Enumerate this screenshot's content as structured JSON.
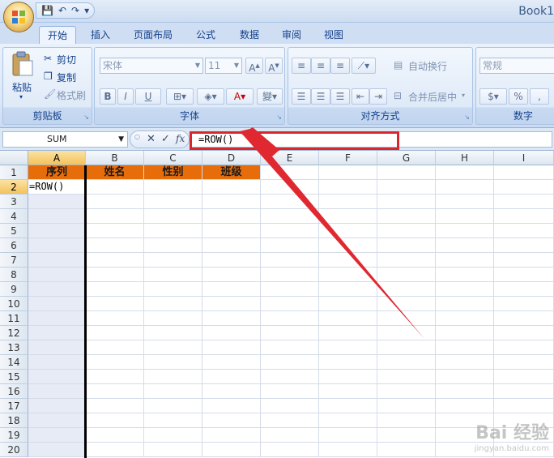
{
  "window": {
    "title": "Book1"
  },
  "quick_access": {
    "save": "💾",
    "undo": "↶",
    "redo": "↷",
    "customize": "▾"
  },
  "tabs": [
    {
      "label": "开始",
      "active": true
    },
    {
      "label": "插入"
    },
    {
      "label": "页面布局"
    },
    {
      "label": "公式"
    },
    {
      "label": "数据"
    },
    {
      "label": "审阅"
    },
    {
      "label": "视图"
    }
  ],
  "ribbon": {
    "clipboard": {
      "label": "剪贴板",
      "paste": "粘贴",
      "cut": "剪切",
      "copy": "复制",
      "format_painter": "格式刷"
    },
    "font": {
      "label": "字体",
      "font_name": "宋体",
      "font_size": "11",
      "bold": "B",
      "italic": "I",
      "underline": "U"
    },
    "alignment": {
      "label": "对齐方式",
      "wrap_text": "自动换行",
      "merge_center": "合并后居中"
    },
    "number": {
      "label": "数字",
      "format": "常规",
      "percent": "%"
    }
  },
  "formula_bar": {
    "name_box": "SUM",
    "cancel": "✕",
    "enter": "✓",
    "fx": "fx",
    "content": "=ROW()"
  },
  "sheet": {
    "columns": [
      "A",
      "B",
      "C",
      "D",
      "E",
      "F",
      "G",
      "H",
      "I"
    ],
    "rows": [
      "1",
      "2",
      "3",
      "4",
      "5",
      "6",
      "7",
      "8",
      "9",
      "10",
      "11",
      "12",
      "13",
      "14",
      "15",
      "16",
      "17",
      "18",
      "19",
      "20"
    ],
    "headers": [
      "序列",
      "姓名",
      "性别",
      "班级"
    ],
    "active_cell": {
      "ref": "A2",
      "value": "=ROW()"
    }
  },
  "colors": {
    "header_fill": "#e66d0a",
    "annotation_red": "#d9262c"
  },
  "watermark": {
    "brand": "Bai 经验",
    "url": "jingyan.baidu.com"
  }
}
